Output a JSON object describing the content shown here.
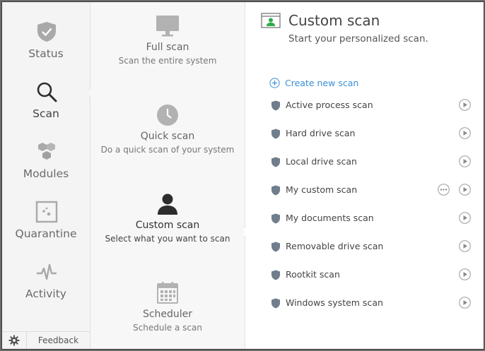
{
  "nav": {
    "items": [
      {
        "label": "Status",
        "icon": "shield-check-icon"
      },
      {
        "label": "Scan",
        "icon": "magnifier-icon"
      },
      {
        "label": "Modules",
        "icon": "hexagons-icon"
      },
      {
        "label": "Quarantine",
        "icon": "quarantine-box-icon"
      },
      {
        "label": "Activity",
        "icon": "pulse-icon"
      }
    ],
    "active": "Scan",
    "footer": {
      "settings_icon": "gear-icon",
      "feedback_label": "Feedback"
    }
  },
  "scan_types": {
    "items": [
      {
        "title": "Full scan",
        "subtitle": "Scan the entire system",
        "icon": "monitor-icon"
      },
      {
        "title": "Quick scan",
        "subtitle": "Do a quick scan of your system",
        "icon": "clock-icon"
      },
      {
        "title": "Custom scan",
        "subtitle": "Select what you want to scan",
        "icon": "user-icon"
      },
      {
        "title": "Scheduler",
        "subtitle": "Schedule a scan",
        "icon": "calendar-icon"
      }
    ],
    "active": "Custom scan"
  },
  "panel": {
    "title": "Custom scan",
    "subtitle": "Start your personalized scan.",
    "header_icon": "user-window-icon",
    "create_label": "Create new scan",
    "scans": [
      "Active process scan",
      "Hard drive scan",
      "Local drive scan",
      "My custom scan",
      "My documents scan",
      "Removable drive scan",
      "Rootkit scan",
      "Windows system scan"
    ],
    "scan_with_options_menu": "My custom scan"
  },
  "colors": {
    "accent": "#3a8fd6",
    "active_icon": "#333333",
    "inactive_icon": "#a8a8a8",
    "header_icon_green": "#2eaa4a"
  }
}
